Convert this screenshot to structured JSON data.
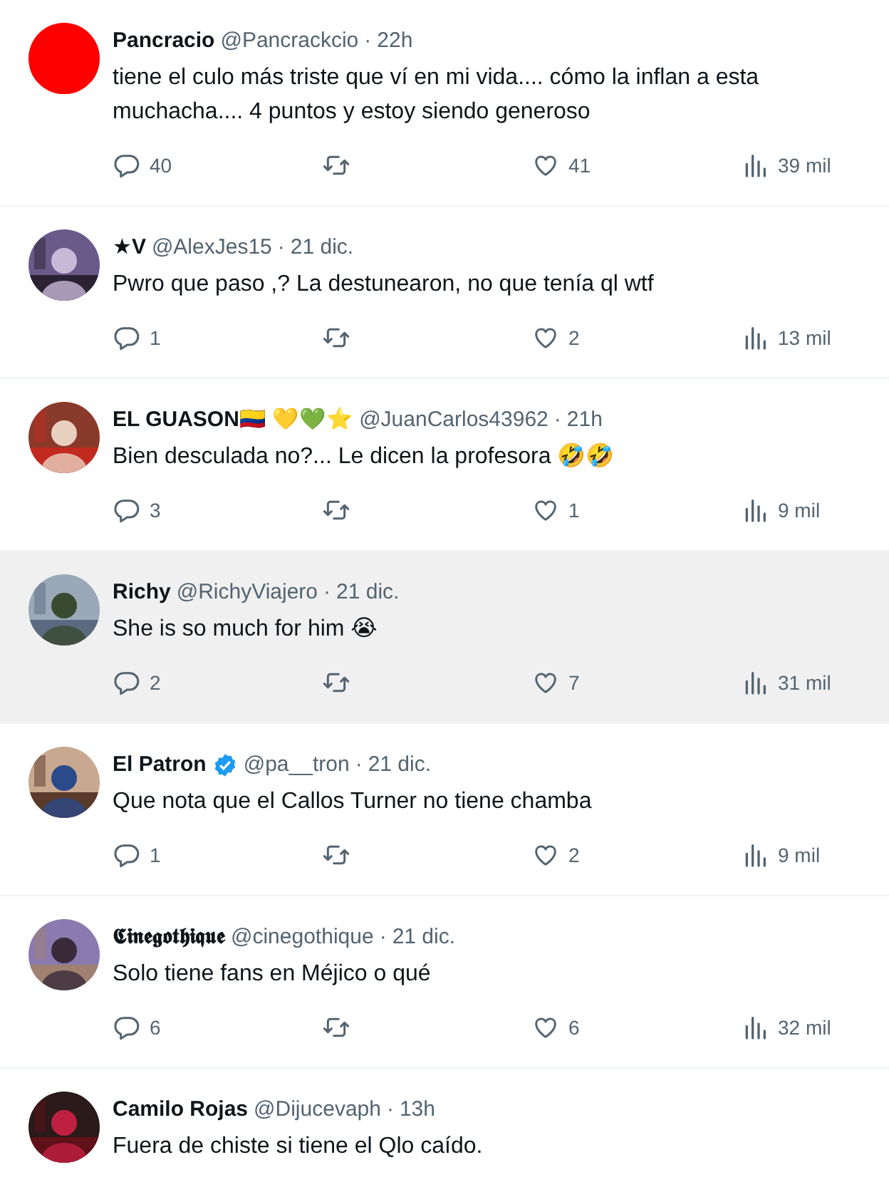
{
  "replies": [
    {
      "name": "Pancracio",
      "verified": false,
      "handle": "@Pancrackcio",
      "dot": "·",
      "time": "22h",
      "text": "tiene el culo más triste que ví en mi vida.... cómo la inflan a esta muchacha.... 4 puntos y estoy siendo generoso",
      "replies": "40",
      "likes": "41",
      "views": "39 mil",
      "highlighted": false
    },
    {
      "name": "★V",
      "verified": false,
      "handle": "@AlexJes15",
      "dot": "·",
      "time": "21 dic.",
      "text": "Pwro que paso ,? La destunearon, no que tenía ql wtf",
      "replies": "1",
      "likes": "2",
      "views": "13 mil",
      "highlighted": false
    },
    {
      "name": "EL GUASON🇨🇴 💛💚⭐",
      "verified": false,
      "handle": "@JuanCarlos43962",
      "dot": "·",
      "time": "21h",
      "text": "Bien desculada no?... Le dicen la profesora 🤣🤣",
      "replies": "3",
      "likes": "1",
      "views": "9 mil",
      "highlighted": false
    },
    {
      "name": "Richy",
      "verified": false,
      "handle": "@RichyViajero",
      "dot": "·",
      "time": "21 dic.",
      "text": "She is so much for him 😭",
      "replies": "2",
      "likes": "7",
      "views": "31 mil",
      "highlighted": true
    },
    {
      "name": "El Patron",
      "verified": true,
      "handle": "@pa__tron",
      "dot": "·",
      "time": "21 dic.",
      "text": "Que nota que el Callos Turner no tiene chamba",
      "replies": "1",
      "likes": "2",
      "views": "9 mil",
      "highlighted": false
    },
    {
      "name": "𝕮𝖎𝖓𝖊𝖌𝖔𝖙𝖍𝖎𝖖𝖚𝖊",
      "verified": false,
      "handle": "@cinegothique",
      "dot": "·",
      "time": "21 dic.",
      "text": "Solo tiene fans en Méjico o qué",
      "replies": "6",
      "likes": "6",
      "views": "32 mil",
      "highlighted": false
    },
    {
      "name": "Camilo Rojas",
      "verified": false,
      "handle": "@Dijucevaph",
      "dot": "·",
      "time": "13h",
      "text": "Fuera de chiste si tiene el Qlo caído."
    }
  ]
}
